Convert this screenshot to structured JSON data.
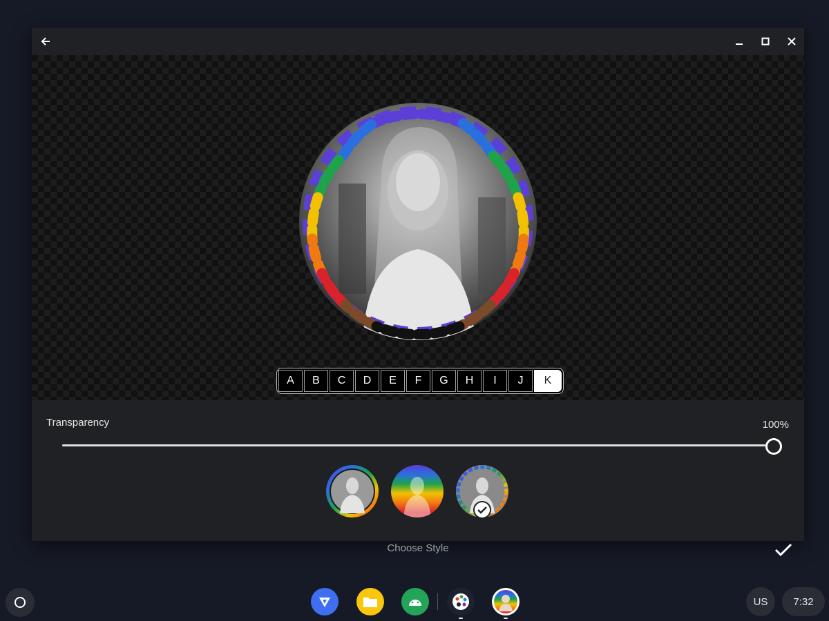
{
  "titlebar": {
    "icons": [
      "back-arrow-icon",
      "minimize-icon",
      "maximize-icon",
      "close-icon"
    ]
  },
  "letter_picker": {
    "letters": [
      "A",
      "B",
      "C",
      "D",
      "E",
      "F",
      "G",
      "H",
      "I",
      "J",
      "K"
    ],
    "selected": "K"
  },
  "transparency": {
    "label": "Transparency",
    "value": "100%",
    "level": 1.0
  },
  "styles": {
    "options": [
      "ring-style",
      "overlay-style",
      "wreath-style"
    ],
    "selected_index": 2,
    "caption": "Choose Style"
  },
  "shelf": {
    "apps": [
      "vpn-app-icon",
      "files-app-icon",
      "android-app-icon",
      "paint-palette-app-icon",
      "profile-frame-app-icon"
    ],
    "keyboard_layout": "US",
    "time": "7:32"
  },
  "colors": {
    "background": "#161a26",
    "window": "#202124",
    "accent": "#ffffff"
  }
}
